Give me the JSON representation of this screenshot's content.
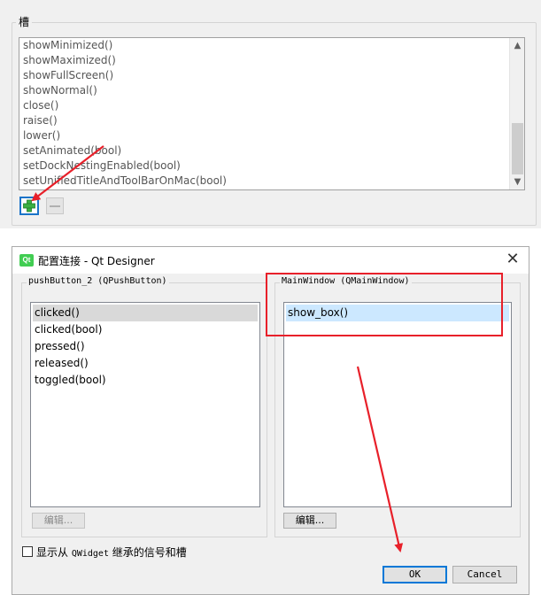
{
  "top_panel": {
    "group_title": "槽",
    "slots": [
      "showMinimized()",
      "showMaximized()",
      "showFullScreen()",
      "showNormal()",
      "close()",
      "raise()",
      "lower()",
      "setAnimated(bool)",
      "setDockNestingEnabled(bool)",
      "setUnifiedTitleAndToolBarOnMac(bool)"
    ],
    "add_button_icon": "plus-icon",
    "remove_button_icon": "minus-icon"
  },
  "dialog": {
    "title": "配置连接 - Qt Designer",
    "logo_text": "Qt",
    "close_glyph": "✕",
    "left_group": {
      "title": "pushButton_2 (QPushButton)",
      "signals": [
        "clicked()",
        "clicked(bool)",
        "pressed()",
        "released()",
        "toggled(bool)"
      ],
      "selected_index": 0,
      "edit_label": "编辑..."
    },
    "right_group": {
      "title": "MainWindow (QMainWindow)",
      "slots": [
        "show_box()"
      ],
      "selected_index": 0,
      "edit_label": "编辑..."
    },
    "checkbox": {
      "label_prefix": "显示从 ",
      "label_code": "QWidget",
      "label_suffix": " 继承的信号和槽",
      "checked": false
    },
    "ok_label": "OK",
    "cancel_label": "Cancel"
  },
  "colors": {
    "annotation_red": "#e8202a",
    "selection_left": "#d9d9d9",
    "selection_right": "#cce8ff",
    "qt_green": "#41cd52"
  }
}
